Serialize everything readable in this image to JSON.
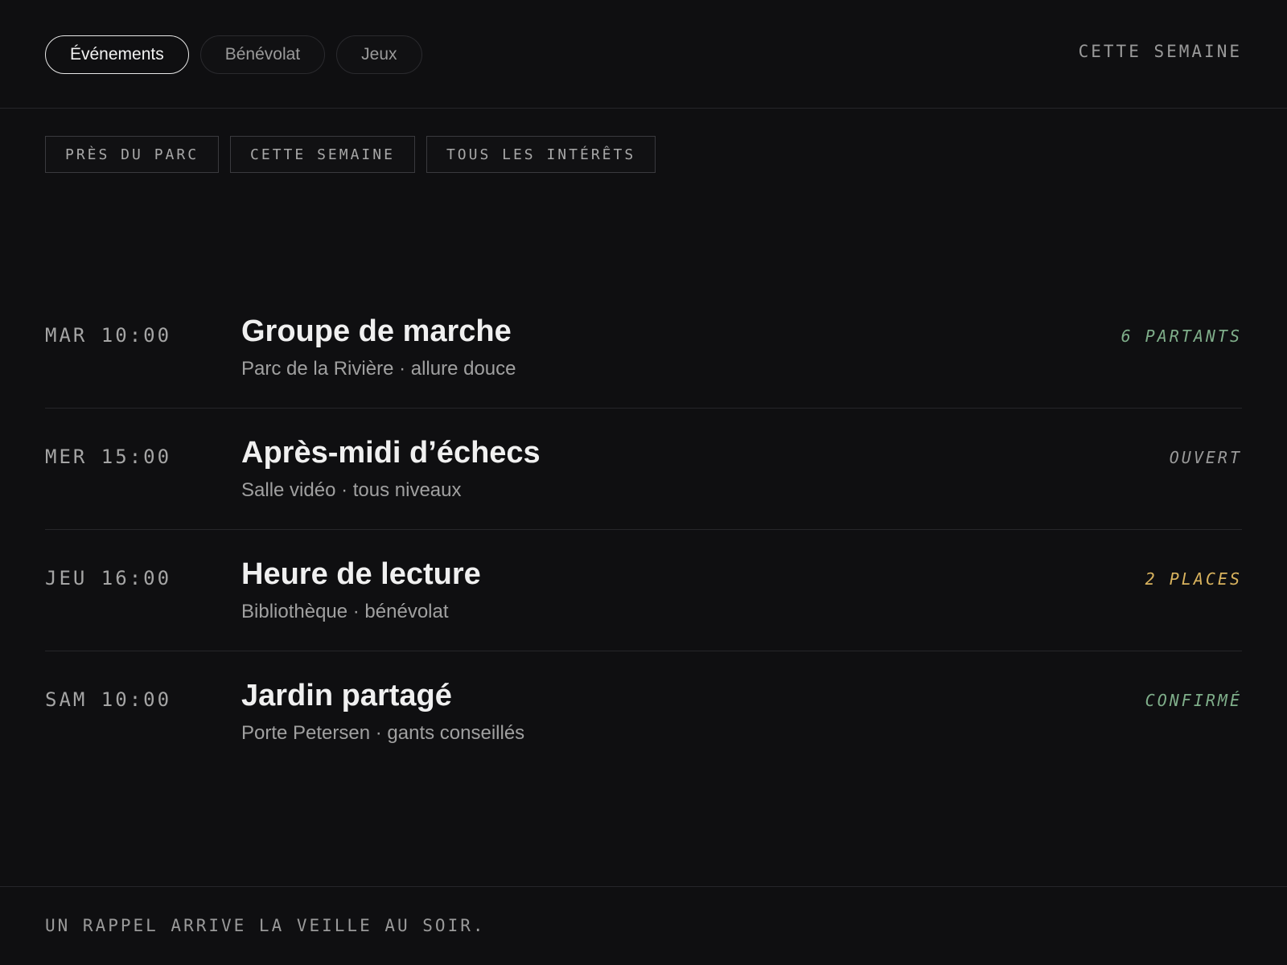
{
  "tabs": [
    {
      "label": "Événements",
      "active": true
    },
    {
      "label": "Bénévolat",
      "active": false
    },
    {
      "label": "Jeux",
      "active": false
    }
  ],
  "header": {
    "period_label": "CETTE SEMAINE"
  },
  "filters": [
    {
      "label": "PRÈS DU PARC"
    },
    {
      "label": "CETTE SEMAINE"
    },
    {
      "label": "TOUS LES INTÉRÊTS"
    }
  ],
  "events": [
    {
      "time": "MAR 10:00",
      "title": "Groupe de marche",
      "details": "Parc de la Rivière · allure douce",
      "status": "6 PARTANTS",
      "status_color": "#7fae8a"
    },
    {
      "time": "MER 15:00",
      "title": "Après-midi d’échecs",
      "details": "Salle vidéo · tous niveaux",
      "status": "OUVERT",
      "status_color": "#9a9a9a"
    },
    {
      "time": "JEU 16:00",
      "title": "Heure de lecture",
      "details": "Bibliothèque · bénévolat",
      "status": "2 PLACES",
      "status_color": "#d9b35e"
    },
    {
      "time": "SAM 10:00",
      "title": "Jardin partagé",
      "details": "Porte Petersen · gants conseillés",
      "status": "CONFIRMÉ",
      "status_color": "#7fae8a"
    }
  ],
  "footer": {
    "note": "UN RAPPEL ARRIVE LA VEILLE AU SOIR."
  }
}
